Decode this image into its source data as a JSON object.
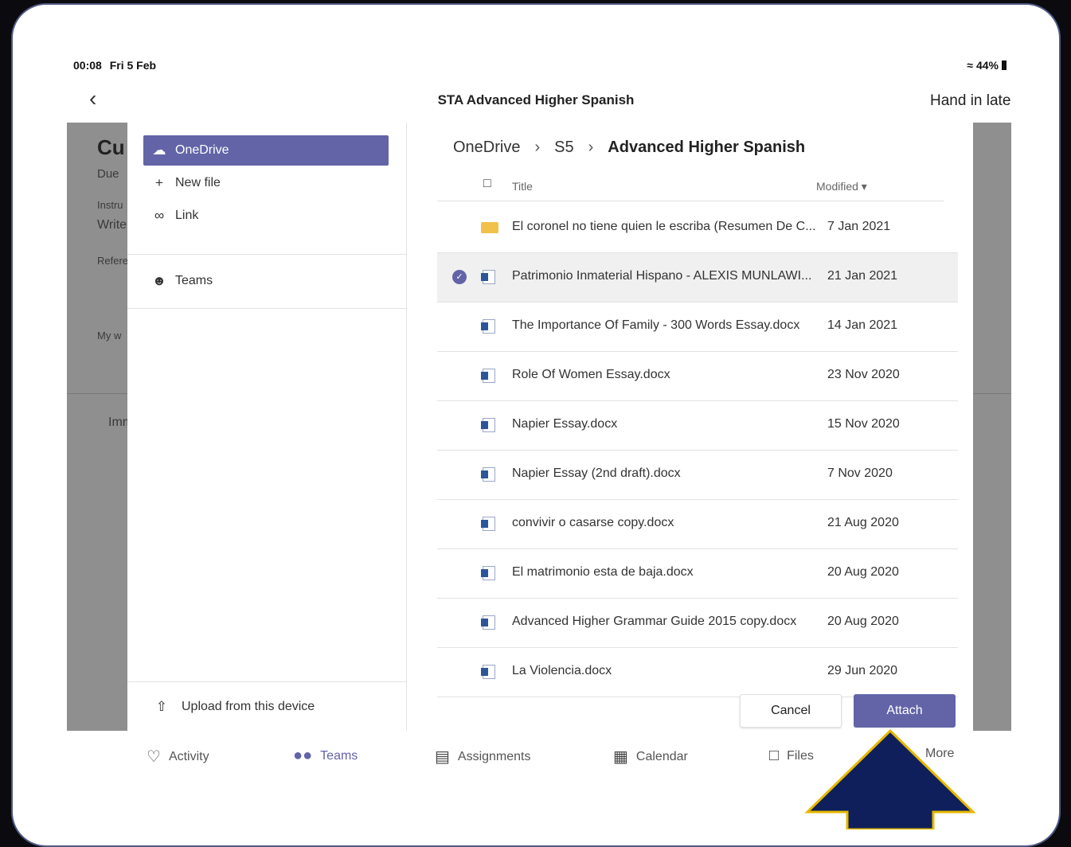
{
  "status": {
    "time": "00:08",
    "date": "Fri 5 Feb",
    "battery": "44%"
  },
  "nav": {
    "title": "STA Advanced Higher Spanish",
    "hand_in": "Hand in late"
  },
  "background": {
    "heading": "Cu",
    "due": "Due",
    "instructions": "Instru",
    "write": "Write",
    "reference": "Refere",
    "my_work": "My w",
    "immersive": "Imm"
  },
  "sources": {
    "onedrive": "OneDrive",
    "new_file": "New file",
    "link": "Link",
    "teams": "Teams",
    "upload": "Upload from this device"
  },
  "breadcrumb": [
    "OneDrive",
    "S5",
    "Advanced Higher Spanish"
  ],
  "table": {
    "title_header": "Title",
    "modified_header": "Modified ▾"
  },
  "files": [
    {
      "name": "El coronel no tiene quien le escriba (Resumen De C...",
      "date": "7 Jan 2021",
      "type": "folder",
      "selected": false
    },
    {
      "name": "Patrimonio Inmaterial Hispano - ALEXIS MUNLAWI...",
      "date": "21 Jan 2021",
      "type": "word",
      "selected": true
    },
    {
      "name": "The Importance Of Family - 300 Words Essay.docx",
      "date": "14 Jan 2021",
      "type": "word",
      "selected": false
    },
    {
      "name": "Role Of Women Essay.docx",
      "date": "23 Nov 2020",
      "type": "word",
      "selected": false
    },
    {
      "name": "Napier Essay.docx",
      "date": "15 Nov 2020",
      "type": "word",
      "selected": false
    },
    {
      "name": "Napier Essay (2nd draft).docx",
      "date": "7 Nov 2020",
      "type": "word",
      "selected": false
    },
    {
      "name": "convivir o casarse copy.docx",
      "date": "21 Aug 2020",
      "type": "word",
      "selected": false
    },
    {
      "name": "El matrimonio esta de baja.docx",
      "date": "20 Aug 2020",
      "type": "word",
      "selected": false
    },
    {
      "name": "Advanced Higher Grammar Guide 2015 copy.docx",
      "date": "20 Aug 2020",
      "type": "word",
      "selected": false
    },
    {
      "name": "La Violencia.docx",
      "date": "29 Jun 2020",
      "type": "word",
      "selected": false
    }
  ],
  "buttons": {
    "cancel": "Cancel",
    "attach": "Attach"
  },
  "tabs": {
    "activity": "Activity",
    "teams": "Teams",
    "assignments": "Assignments",
    "calendar": "Calendar",
    "files": "Files",
    "more": "More"
  },
  "colors": {
    "accent": "#6264a7",
    "arrow_fill": "#0f1f5c",
    "arrow_outline": "#e6b800"
  }
}
